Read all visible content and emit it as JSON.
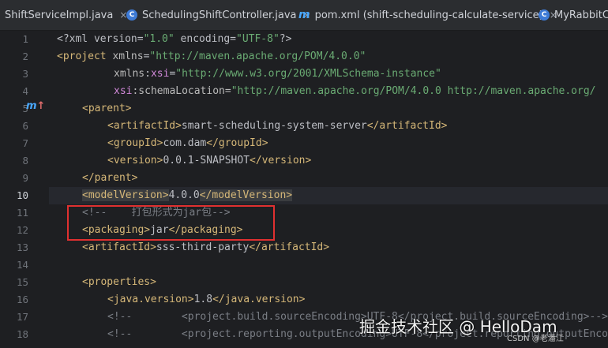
{
  "tabs": [
    {
      "label": "ShiftServiceImpl.java",
      "icon": "java-class-icon",
      "close": "×"
    },
    {
      "label": "SchedulingShiftController.java",
      "icon": "java-class-icon",
      "close": "×"
    },
    {
      "label": "pom.xml (shift-scheduling-calculate-service)",
      "icon": "maven-icon",
      "close": "×"
    },
    {
      "label": "MyRabbitC",
      "icon": "java-class-icon",
      "close": ""
    }
  ],
  "editor": {
    "current_line": 10,
    "line_numbers": [
      "1",
      "2",
      "3",
      "4",
      "5",
      "6",
      "7",
      "8",
      "9",
      "10",
      "11",
      "12",
      "13",
      "14",
      "15",
      "16",
      "17",
      "18"
    ],
    "gutter_marker": "m",
    "lines": {
      "l1": {
        "a": "<?xml version=",
        "b": "\"1.0\"",
        "c": " encoding=",
        "d": "\"UTF-8\"",
        "e": "?>"
      },
      "l2": {
        "a": "<project ",
        "b": "xmlns",
        "c": "=",
        "d": "\"http://maven.apache.org/POM/4.0.0\""
      },
      "l3": {
        "b": "xmlns",
        "c": ":",
        "d": "xsi",
        "e": "=",
        "f": "\"http://www.w3.org/2001/XMLSchema-instance\""
      },
      "l4": {
        "b": "xsi",
        "c": ":schemaLocation=",
        "d": "\"http://maven.apache.org/POM/4.0.0 http://maven.apache.org/"
      },
      "l5": {
        "a": "<parent>"
      },
      "l6": {
        "a": "<artifactId>",
        "b": "smart-scheduling-system-server",
        "c": "</artifactId>"
      },
      "l7": {
        "a": "<groupId>",
        "b": "com.dam",
        "c": "</groupId>"
      },
      "l8": {
        "a": "<version>",
        "b": "0.0.1-SNAPSHOT",
        "c": "</version>"
      },
      "l9": {
        "a": "</parent>"
      },
      "l10": {
        "a": "<modelVersion>",
        "b": "4.0.0",
        "c": "</modelVersion>"
      },
      "l11": {
        "a": "<!--    打包形式为jar包-->"
      },
      "l12": {
        "a": "<packaging>",
        "b": "jar",
        "c": "</packaging>"
      },
      "l13": {
        "a": "<artifactId>",
        "b": "sss-third-party",
        "c": "</artifactId>"
      },
      "l15": {
        "a": "<properties>"
      },
      "l16": {
        "a": "<java.version>",
        "b": "1.8",
        "c": "</java.version>"
      },
      "l17": {
        "a": "<!--        <project.build.sourceEncoding>UTF-8</project.build.sourceEncoding>-->"
      },
      "l18": {
        "a": "<!--        <project.reporting.outputEncoding>UTF-8</project.reporting.outputEncoding>-->"
      }
    }
  },
  "watermark": {
    "main": "掘金技术社区 @ HelloDam",
    "sub": "CSDN @老潘江"
  }
}
